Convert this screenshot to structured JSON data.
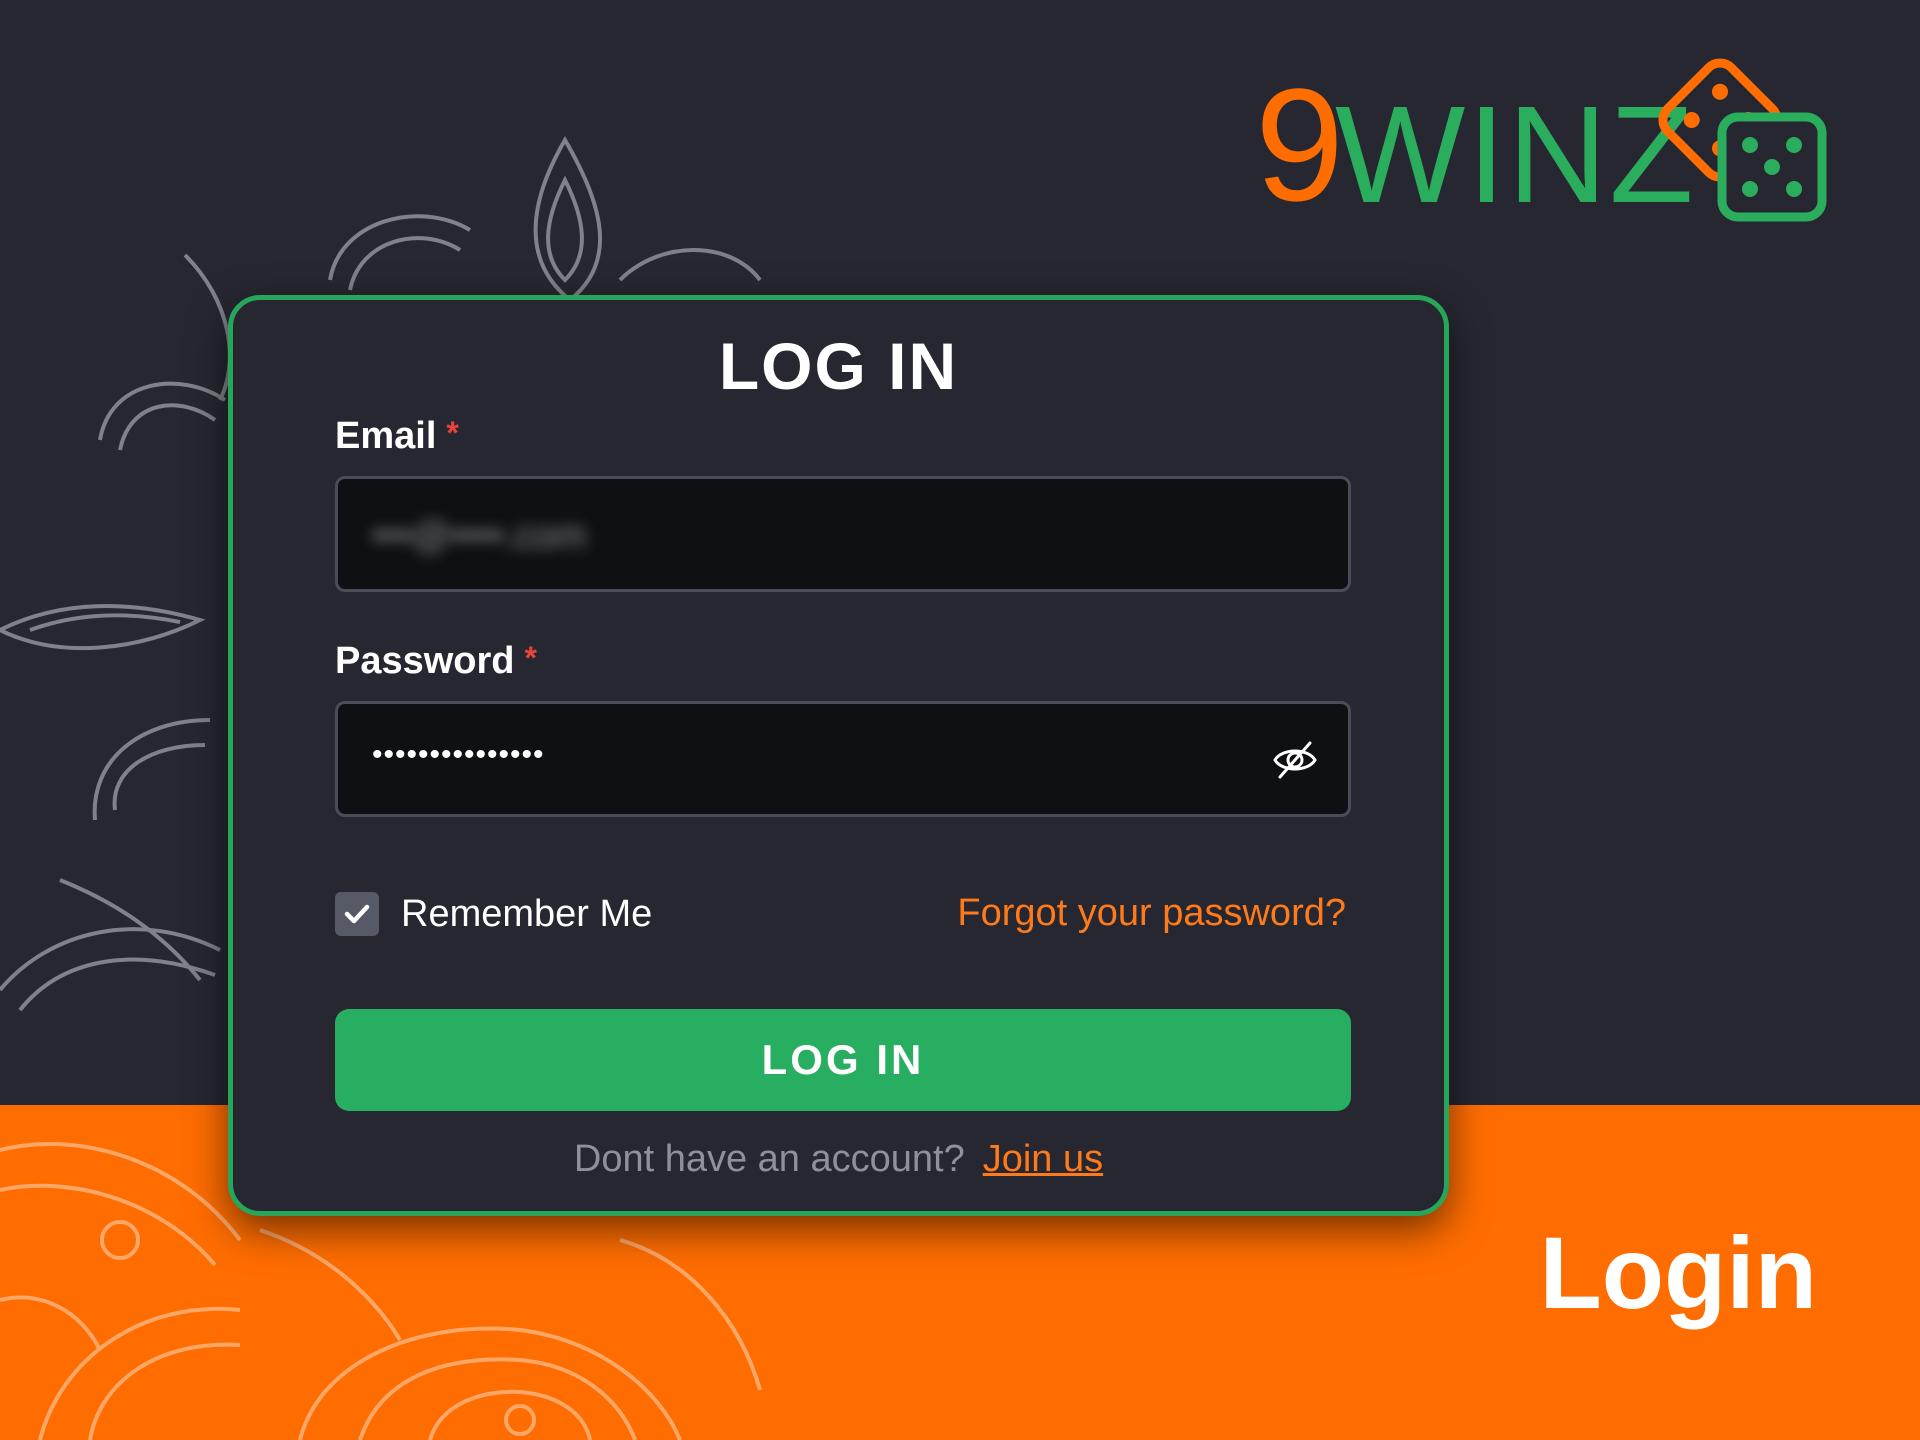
{
  "brand": {
    "logo_number": "9",
    "logo_word": "WINZ",
    "colors": {
      "orange": "#FF6D00",
      "green": "#2AAE5E",
      "dark": "#262730"
    }
  },
  "login_card": {
    "title": "LOG IN",
    "email": {
      "label": "Email",
      "required_mark": "*",
      "value": "•••@••••.com"
    },
    "password": {
      "label": "Password",
      "required_mark": "*",
      "value": "•••••••••••••••",
      "toggle_icon": "eye-slash-icon"
    },
    "remember_me": {
      "label": "Remember Me",
      "checked": true
    },
    "forgot_link": "Forgot your password?",
    "submit_label": "LOG IN",
    "signup_prompt": "Dont have an account?",
    "signup_link": "Join us"
  },
  "page_caption": "Login"
}
